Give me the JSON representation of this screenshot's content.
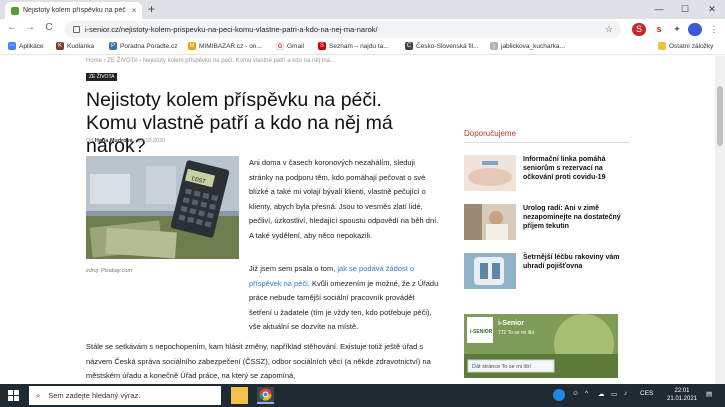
{
  "browser": {
    "tab_title": "Nejistoty kolem příspěvku na péč",
    "tab_close": "×",
    "new_tab": "+",
    "url": "i-senior.cz/nejistoty-kolem-prispevku-na-peci-komu-vlastne-patri-a-kdo-na-nej-ma-narok/",
    "nav": {
      "back": "←",
      "forward": "→",
      "reload": "C"
    },
    "window": {
      "minimize": "—",
      "maximize": "☐",
      "close": "✕"
    },
    "extensions": {
      "badge": "S",
      "pinned": "s",
      "puzzle": "✦",
      "menu": "⋮"
    }
  },
  "bookmarks": [
    {
      "label": "Aplikace",
      "color": "#4285f4",
      "glyph": "⋯"
    },
    {
      "label": "Kudlanka",
      "color": "#7a3e2a",
      "glyph": "K"
    },
    {
      "label": "Poradna Poradte.cz",
      "color": "#3b6fb6",
      "glyph": "P"
    },
    {
      "label": "MIMIBAZAR.cz - on...",
      "color": "#e6a600",
      "glyph": "M"
    },
    {
      "label": "Gmail",
      "color": "#c9c9c9",
      "glyph": "G"
    },
    {
      "label": "Seznam – najdu ta...",
      "color": "#cc0000",
      "glyph": "S"
    },
    {
      "label": "Česko-Slovenská fil...",
      "color": "#444444",
      "glyph": "Č"
    },
    {
      "label": "jablickova_kucharka...",
      "color": "#b0b0b0",
      "glyph": "j"
    },
    {
      "label": "Ostatní záložky",
      "color": "#f1c232",
      "glyph": ""
    }
  ],
  "article": {
    "breadcrumb": "Home  ›  ZE ŽIVOTA  ›  Nejistoty kolem příspěvku na péči. Komu vlastně patří a kdo na něj má...",
    "category": "ZE ŽIVOTA",
    "title": "Nejistoty kolem příspěvku na péči. Komu vlastně patří a kdo na něj má nárok?",
    "author_prefix": "Od",
    "author": "Hana Mudrová",
    "date": "15.10.2020",
    "image_caption": "zdroj: Pixabay.com",
    "calc_display": "COST",
    "p1": "Ani doma v časech koronových nezahálím, sleduji stránky na podporu těm, kdo pomáhají pečovat o své blízké a také mi volají bývalí klienti, vlastně pečující o klienty, abych byla přesná. Jsou to vesměs zlatí lidé, pečliví, úzkostliví, hledající spoustu odpovědí na běh dní. A také vydělení, aby něco nepokazili.",
    "p2_a": "Již jsem sem psala o tom,",
    "p2_link": "jak se podává žádost o příspěvek na péči",
    "p2_b": ". Kvůli omezením je možné, že z Úřadu práce nebude tamější sociální pracovník provádět šetření u žadatele (tím je vždy ten, kdo potřebuje péči), vše aktuální se dozvíte na místě.",
    "p3": "Stále se setkávám s nepochopením, kam hlásit změny, například stěhování. Existuje totiž ještě úřad s názvem Česká správa sociálního zabezpečení (ČSSZ), odbor sociálních věcí (a někde zdravotnictví) na městském úřadu a konečně Úřad práce, na který se zapomíná,"
  },
  "sidebar": {
    "title": "Doporučujeme",
    "items": [
      {
        "title": "Informační linka pomáhá seniorům s rezervací na očkování proti covidu-19"
      },
      {
        "title": "Urolog radí: Ani v zimě nezapomínejte na dostatečný příjem tekutin"
      },
      {
        "title": "Šetrnější léčbu rakoviny vám uhradí pojišťovna"
      }
    ],
    "fb": {
      "name": "i-Senior",
      "likes": "772 To se mi líbí",
      "button": "Dát stránce To se mi líbí",
      "logo": "i-SENIOR"
    }
  },
  "taskbar": {
    "search_placeholder": "Sem zadejte hledaný výraz.",
    "lang": "CES",
    "time": "22:01",
    "date": "21.01.2021"
  }
}
